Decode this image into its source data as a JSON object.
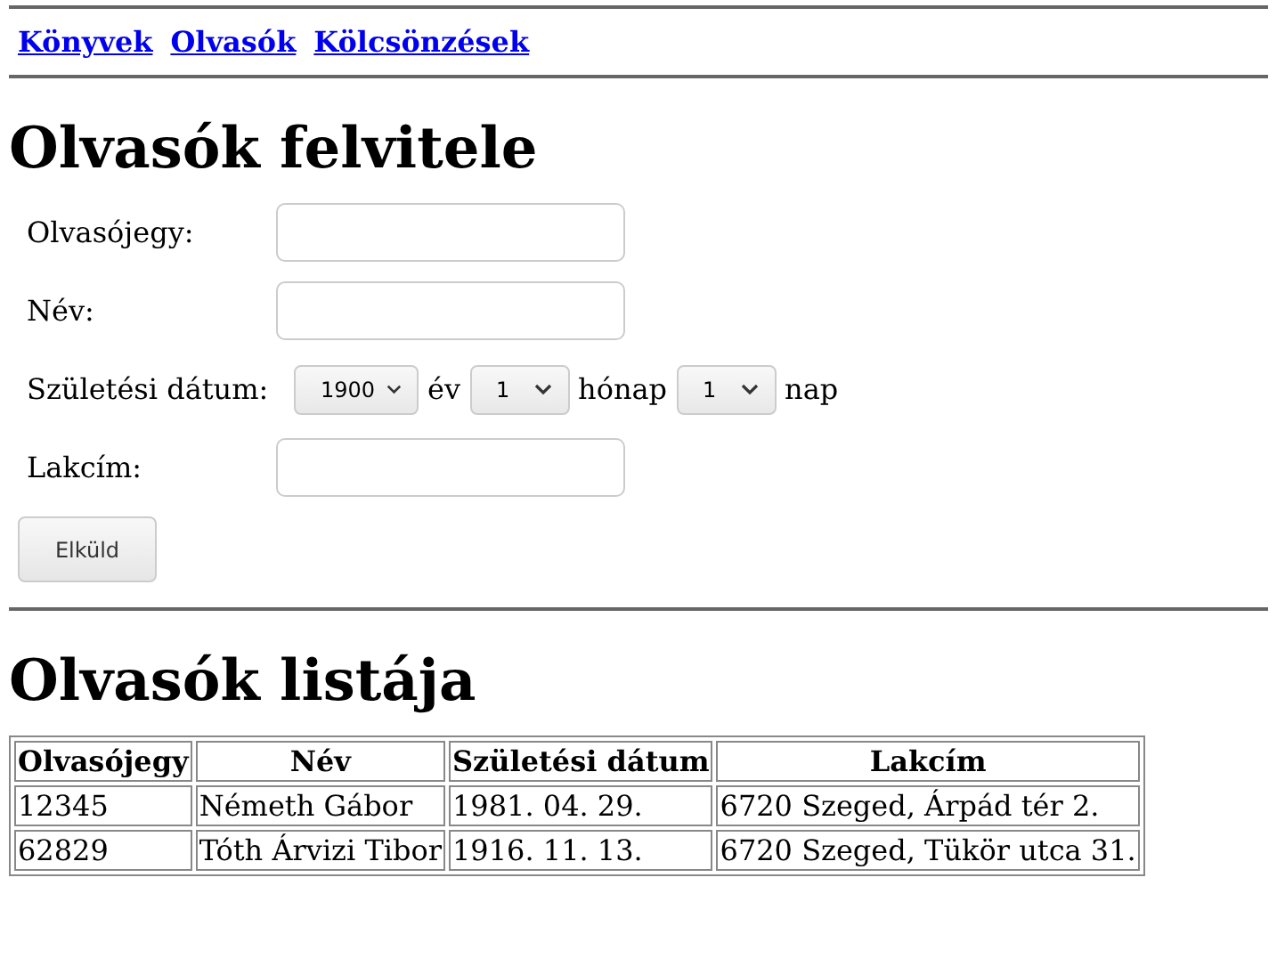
{
  "nav": [
    {
      "label": "Könyvek"
    },
    {
      "label": "Olvasók"
    },
    {
      "label": "Kölcsönzések"
    }
  ],
  "form": {
    "title": "Olvasók felvitele",
    "fields": [
      {
        "kind": "text",
        "label": "Olvasójegy:"
      },
      {
        "kind": "text",
        "label": "Név:"
      },
      {
        "kind": "date",
        "label": "Születési dátum:",
        "parts": [
          {
            "value": "1900",
            "unit": "év"
          },
          {
            "value": "1",
            "unit": "hónap"
          },
          {
            "value": "1",
            "unit": "nap"
          }
        ]
      },
      {
        "kind": "text",
        "label": "Lakcím:"
      }
    ],
    "submit": "Elküld"
  },
  "list": {
    "title": "Olvasók listája",
    "columns": [
      "Olvasójegy",
      "Név",
      "Születési dátum",
      "Lakcím"
    ],
    "rows": [
      [
        "12345",
        "Németh Gábor",
        "1981. 04. 29.",
        "6720 Szeged, Árpád tér 2."
      ],
      [
        "62829",
        "Tóth Árvizi Tibor",
        "1916. 11. 13.",
        "6720 Szeged, Tükör utca 31."
      ]
    ]
  }
}
